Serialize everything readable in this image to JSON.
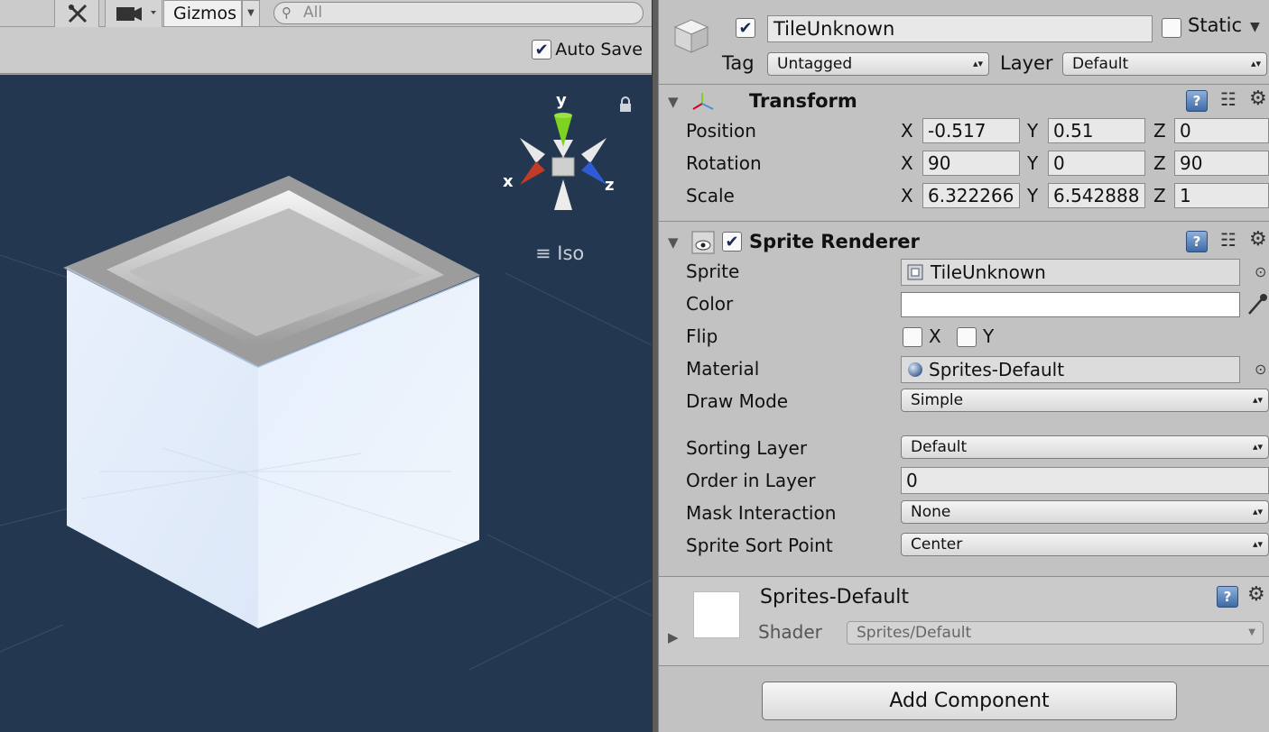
{
  "scene": {
    "toolbar": {
      "gizmos_label": "Gizmos",
      "search_placeholder": "All"
    },
    "auto_save_label": "Auto Save",
    "auto_save_checked": true,
    "orientation_gizmo": {
      "x_label": "x",
      "y_label": "y",
      "z_label": "z"
    },
    "projection_label": "Iso"
  },
  "inspector": {
    "object_name": "TileUnknown",
    "active_checked": true,
    "static_label": "Static",
    "static_checked": false,
    "tag_label": "Tag",
    "tag_value": "Untagged",
    "layer_label": "Layer",
    "layer_value": "Default",
    "transform": {
      "title": "Transform",
      "position_label": "Position",
      "rotation_label": "Rotation",
      "scale_label": "Scale",
      "axis_x": "X",
      "axis_y": "Y",
      "axis_z": "Z",
      "position": {
        "x": "-0.517",
        "y": "0.51",
        "z": "0"
      },
      "rotation": {
        "x": "90",
        "y": "0",
        "z": "90"
      },
      "scale": {
        "x": "6.322266",
        "y": "6.542888",
        "z": "1"
      }
    },
    "sprite_renderer": {
      "title": "Sprite Renderer",
      "enabled": true,
      "sprite_label": "Sprite",
      "sprite_value": "TileUnknown",
      "color_label": "Color",
      "color_value": "#ffffff",
      "flip_label": "Flip",
      "flip_x_label": "X",
      "flip_y_label": "Y",
      "material_label": "Material",
      "material_value": "Sprites-Default",
      "draw_mode_label": "Draw Mode",
      "draw_mode_value": "Simple",
      "sorting_layer_label": "Sorting Layer",
      "sorting_layer_value": "Default",
      "order_label": "Order in Layer",
      "order_value": "0",
      "mask_label": "Mask Interaction",
      "mask_value": "None",
      "sort_point_label": "Sprite Sort Point",
      "sort_point_value": "Center"
    },
    "material": {
      "name": "Sprites-Default",
      "shader_label": "Shader",
      "shader_value": "Sprites/Default"
    },
    "add_component_label": "Add Component"
  }
}
